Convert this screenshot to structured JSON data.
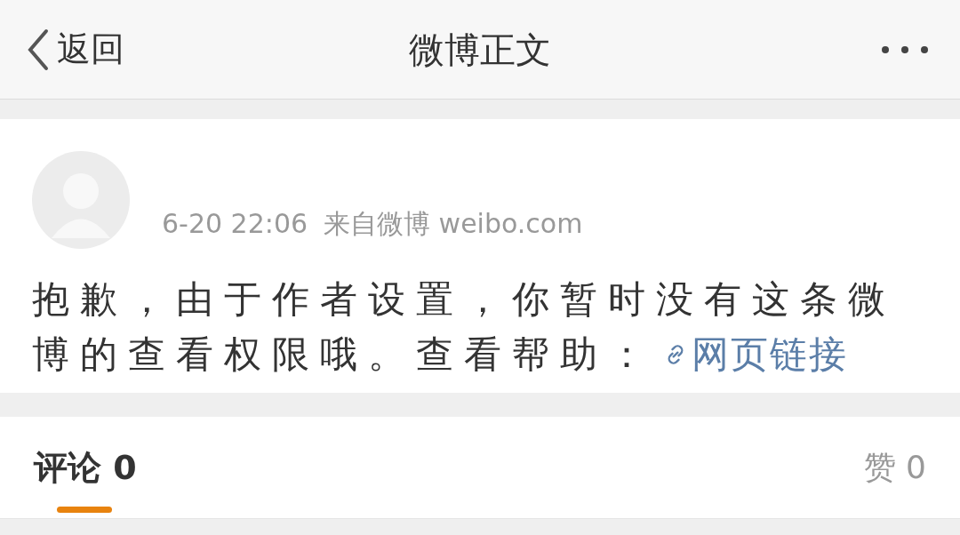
{
  "nav": {
    "back": "返回",
    "title": "微博正文"
  },
  "post": {
    "time": "6-20 22:06",
    "source": "来自微博 weibo.com",
    "text": "抱歉，由于作者设置，你暂时没有这条微博的查看权限哦。查看帮助：",
    "link": "网页链接"
  },
  "tabs": [
    {
      "label": "评论 0",
      "selected": true
    },
    {
      "label": "赞 0",
      "selected": false
    }
  ]
}
